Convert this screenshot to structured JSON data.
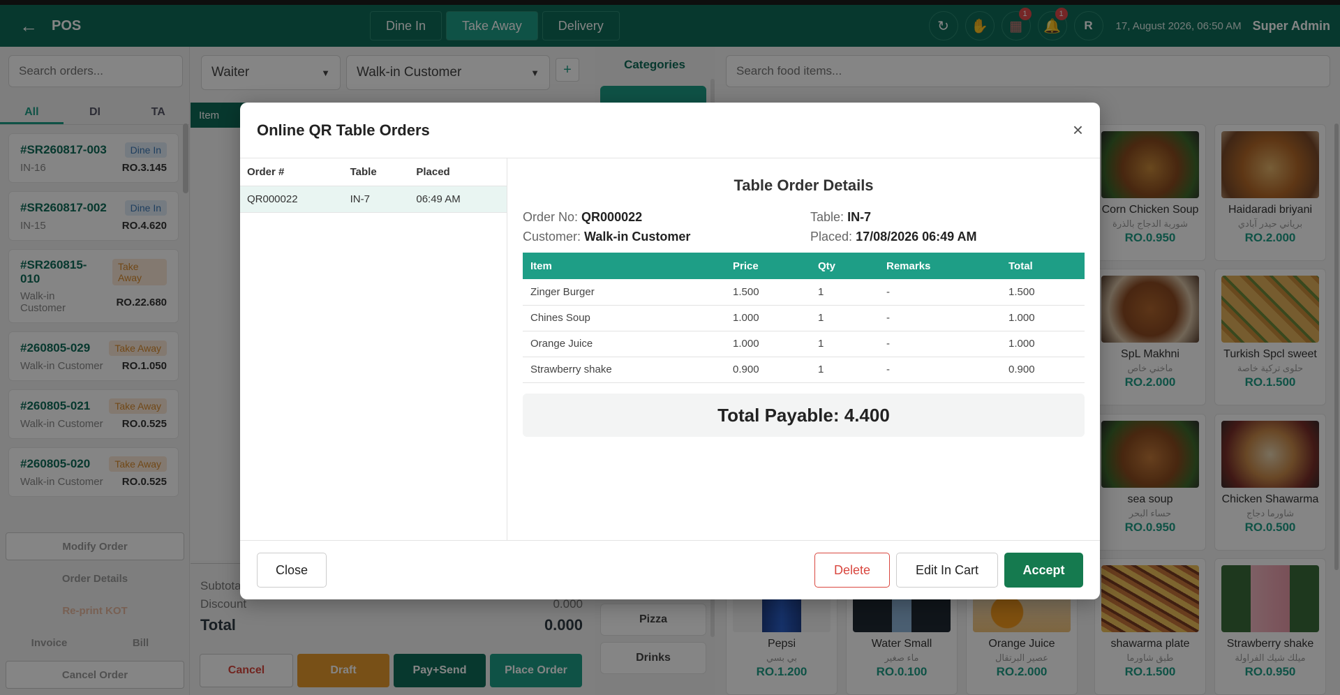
{
  "topbar": {
    "title": "POS",
    "modes": [
      "Dine In",
      "Take Away",
      "Delivery"
    ],
    "datetime": "17, August 2026, 06:50 AM",
    "user": "Super Admin",
    "avatar_initial": "R",
    "kitchen_badge": "1",
    "notif_badge": "1"
  },
  "left": {
    "search_placeholder": "Search orders...",
    "tabs": [
      "All",
      "DI",
      "TA"
    ],
    "orders": [
      {
        "id": "#SR260817-003",
        "type": "Dine In",
        "sub": "IN-16",
        "amount": "RO.3.145"
      },
      {
        "id": "#SR260817-002",
        "type": "Dine In",
        "sub": "IN-15",
        "amount": "RO.4.620"
      },
      {
        "id": "#SR260815-010",
        "type": "Take Away",
        "sub": "Walk-in Customer",
        "amount": "RO.22.680"
      },
      {
        "id": "#260805-029",
        "type": "Take Away",
        "sub": "Walk-in Customer",
        "amount": "RO.1.050"
      },
      {
        "id": "#260805-021",
        "type": "Take Away",
        "sub": "Walk-in Customer",
        "amount": "RO.0.525"
      },
      {
        "id": "#260805-020",
        "type": "Take Away",
        "sub": "Walk-in Customer",
        "amount": "RO.0.525"
      }
    ],
    "actions": {
      "modify": "Modify Order",
      "details": "Order Details",
      "reprint": "Re-print KOT",
      "invoice": "Invoice",
      "bill": "Bill",
      "cancel": "Cancel Order"
    }
  },
  "cart": {
    "waiter": "Waiter",
    "customer": "Walk-in Customer",
    "plus": "+",
    "item_header": "Item",
    "subtotal_label": "Subtota",
    "discount_label": "Discount",
    "discount_value": "0.000",
    "total_label": "Total",
    "total_value": "0.000",
    "buttons": {
      "cancel": "Cancel",
      "draft": "Draft",
      "pay_send": "Pay+Send",
      "place": "Place Order"
    }
  },
  "categories": {
    "title": "Categories",
    "items": [
      "Pizza",
      "Drinks"
    ]
  },
  "food": {
    "search_placeholder": "Search food items...",
    "items": [
      {
        "name": "Corn Chicken Soup",
        "ar": "شوربة الدجاج بالذرة",
        "price": "RO.0.950"
      },
      {
        "name": "Haidaradi briyani",
        "ar": "برياني حيدر آبادي",
        "price": "RO.2.000"
      },
      {
        "name": "SpL Makhni",
        "ar": "ماخني خاص",
        "price": "RO.2.000"
      },
      {
        "name": "Turkish Spcl sweet",
        "ar": "حلوى تركية خاصة",
        "price": "RO.1.500"
      },
      {
        "name": "sea soup",
        "ar": "حساء البحر",
        "price": "RO.0.950"
      },
      {
        "name": "Chicken Shawarma",
        "ar": "شاورما دجاج",
        "price": "RO.0.500"
      },
      {
        "name": "Pepsi",
        "ar": "بي بسي",
        "price": "RO.1.200"
      },
      {
        "name": "Water Small",
        "ar": "ماء صغير",
        "price": "RO.0.100"
      },
      {
        "name": "Orange Juice",
        "ar": "عصير البرتقال",
        "price": "RO.2.000"
      },
      {
        "name": "shawarma plate",
        "ar": "طبق شاورما",
        "price": "RO.1.500"
      },
      {
        "name": "Strawberry shake",
        "ar": "ميلك شيك الفراولة",
        "price": "RO.0.950"
      }
    ]
  },
  "modal": {
    "title": "Online QR Table Orders",
    "list_headers": [
      "Order #",
      "Table",
      "Placed"
    ],
    "list_rows": [
      {
        "order": "QR000022",
        "table": "IN-7",
        "placed": "06:49 AM"
      }
    ],
    "details_title": "Table Order Details",
    "order_no_label": "Order No:",
    "order_no": "QR000022",
    "table_label": "Table:",
    "table": "IN-7",
    "customer_label": "Customer:",
    "customer": "Walk-in Customer",
    "placed_label": "Placed:",
    "placed": "17/08/2026 06:49 AM",
    "item_headers": [
      "Item",
      "Price",
      "Qty",
      "Remarks",
      "Total"
    ],
    "items": [
      {
        "item": "Zinger Burger",
        "price": "1.500",
        "qty": "1",
        "remarks": "-",
        "total": "1.500"
      },
      {
        "item": "Chines Soup",
        "price": "1.000",
        "qty": "1",
        "remarks": "-",
        "total": "1.000"
      },
      {
        "item": "Orange Juice",
        "price": "1.000",
        "qty": "1",
        "remarks": "-",
        "total": "1.000"
      },
      {
        "item": "Strawberry shake",
        "price": "0.900",
        "qty": "1",
        "remarks": "-",
        "total": "0.900"
      }
    ],
    "total_payable": "Total Payable: 4.400",
    "buttons": {
      "close": "Close",
      "delete": "Delete",
      "edit": "Edit In Cart",
      "accept": "Accept"
    }
  },
  "colors": {
    "primary": "#0f6b58",
    "accent": "#1e9e86",
    "danger": "#d9473f",
    "draft": "#e79a2c"
  }
}
